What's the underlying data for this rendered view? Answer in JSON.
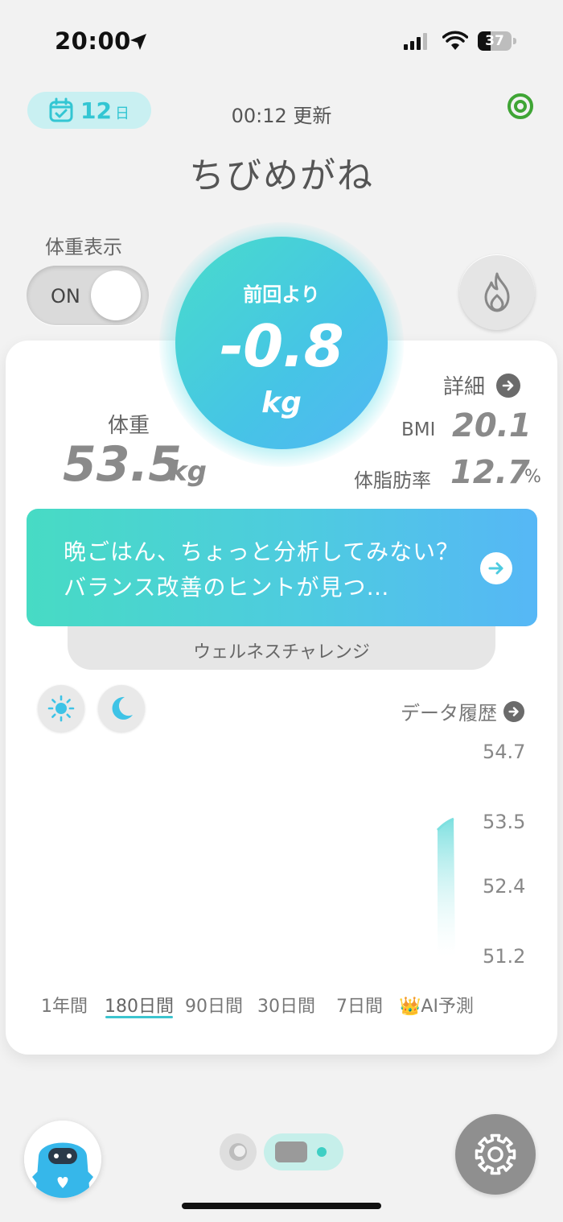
{
  "status_bar": {
    "time": "20:00",
    "battery": "37",
    "battery_level": 0.37
  },
  "header": {
    "streak_days": "12",
    "streak_unit": "日",
    "updated": "00:12 更新",
    "title": "ちびめがね"
  },
  "weight_toggle": {
    "label": "体重表示",
    "state": "ON"
  },
  "change": {
    "label": "前回より",
    "value": "-0.8",
    "unit": "kg"
  },
  "stats": {
    "weight_label": "体重",
    "weight_value": "53.5",
    "weight_unit": "kg",
    "detail_label": "詳細",
    "bmi_label": "BMI",
    "bmi_value": "20.1",
    "fat_label": "体脂肪率",
    "fat_value": "12.7",
    "fat_unit": "%"
  },
  "banner": {
    "text": "晩ごはん、ちょっと分析してみない？バランス改善のヒントが見つ…",
    "challenge": "ウェルネスチャレンジ"
  },
  "chart_controls": {
    "history_label": "データ履歴"
  },
  "chart_data": {
    "type": "area",
    "y_ticks": [
      "54.7",
      "53.5",
      "52.4",
      "51.2"
    ],
    "ylim": [
      51.2,
      54.7
    ],
    "x": [
      "latest"
    ],
    "values": [
      53.5
    ],
    "colors": {
      "fill_top": "#7ee0e0",
      "fill_bottom": "#ffffff"
    }
  },
  "range_tabs": [
    {
      "label": "1年間",
      "active": false
    },
    {
      "label": "180日間",
      "active": true
    },
    {
      "label": "90日間",
      "active": false
    },
    {
      "label": "30日間",
      "active": false
    },
    {
      "label": "7日間",
      "active": false
    },
    {
      "label": "👑AI予測",
      "active": false
    }
  ],
  "colors": {
    "accent": "#3cc4cf",
    "primary_gradient_start": "#48dccb",
    "primary_gradient_end": "#52b6f4"
  }
}
